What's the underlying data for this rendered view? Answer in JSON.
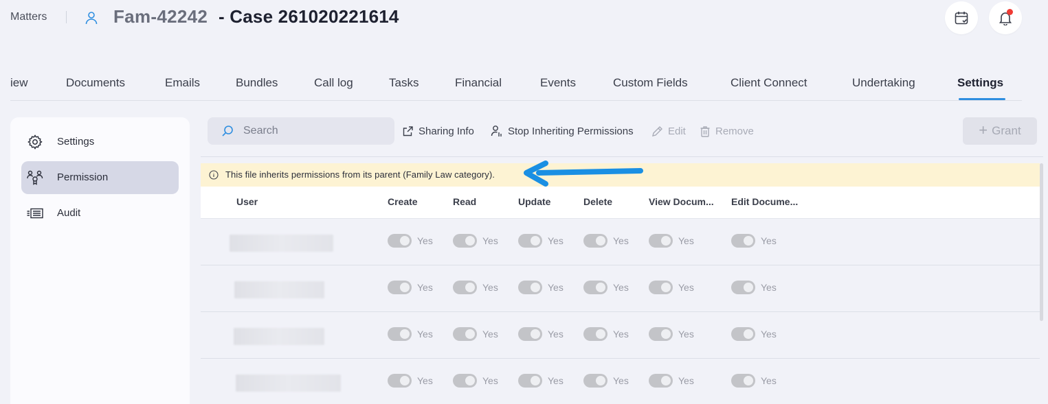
{
  "header": {
    "breadcrumb": "Matters",
    "matter_code": "Fam-42242",
    "matter_title": "- Case 261020221614",
    "notification_color": "#ef3b34"
  },
  "tabs": [
    {
      "label": "iew"
    },
    {
      "label": "Documents"
    },
    {
      "label": "Emails"
    },
    {
      "label": "Bundles"
    },
    {
      "label": "Call log"
    },
    {
      "label": "Tasks"
    },
    {
      "label": "Financial"
    },
    {
      "label": "Events"
    },
    {
      "label": "Custom Fields"
    },
    {
      "label": "Client Connect"
    },
    {
      "label": "Undertaking"
    },
    {
      "label": "Settings",
      "active": true
    }
  ],
  "sidebar": {
    "items": [
      {
        "label": "Settings",
        "icon": "gear-icon"
      },
      {
        "label": "Permission",
        "icon": "users-permission-icon",
        "active": true
      },
      {
        "label": "Audit",
        "icon": "audit-list-icon"
      }
    ]
  },
  "toolbar": {
    "search_placeholder": "Search",
    "sharing_info": "Sharing Info",
    "stop_inheriting": "Stop Inheriting Permissions",
    "edit": "Edit",
    "remove": "Remove",
    "grant": "Grant"
  },
  "banner": {
    "text": "This file inherits permissions from its parent (Family Law category).",
    "arrow_color": "#1a8fe3"
  },
  "table": {
    "columns": [
      "User",
      "Create",
      "Read",
      "Update",
      "Delete",
      "View Docum...",
      "Edit Docume..."
    ],
    "rows": [
      {
        "cells": [
          "Yes",
          "Yes",
          "Yes",
          "Yes",
          "Yes",
          "Yes"
        ]
      },
      {
        "cells": [
          "Yes",
          "Yes",
          "Yes",
          "Yes",
          "Yes",
          "Yes"
        ]
      },
      {
        "cells": [
          "Yes",
          "Yes",
          "Yes",
          "Yes",
          "Yes",
          "Yes"
        ]
      },
      {
        "cells": [
          "Yes",
          "Yes",
          "Yes",
          "Yes",
          "Yes",
          "Yes"
        ]
      }
    ]
  },
  "colors": {
    "accent": "#2e8ee0",
    "banner_bg": "#fdf3d3",
    "active_nav_bg": "#d6d8e6"
  }
}
